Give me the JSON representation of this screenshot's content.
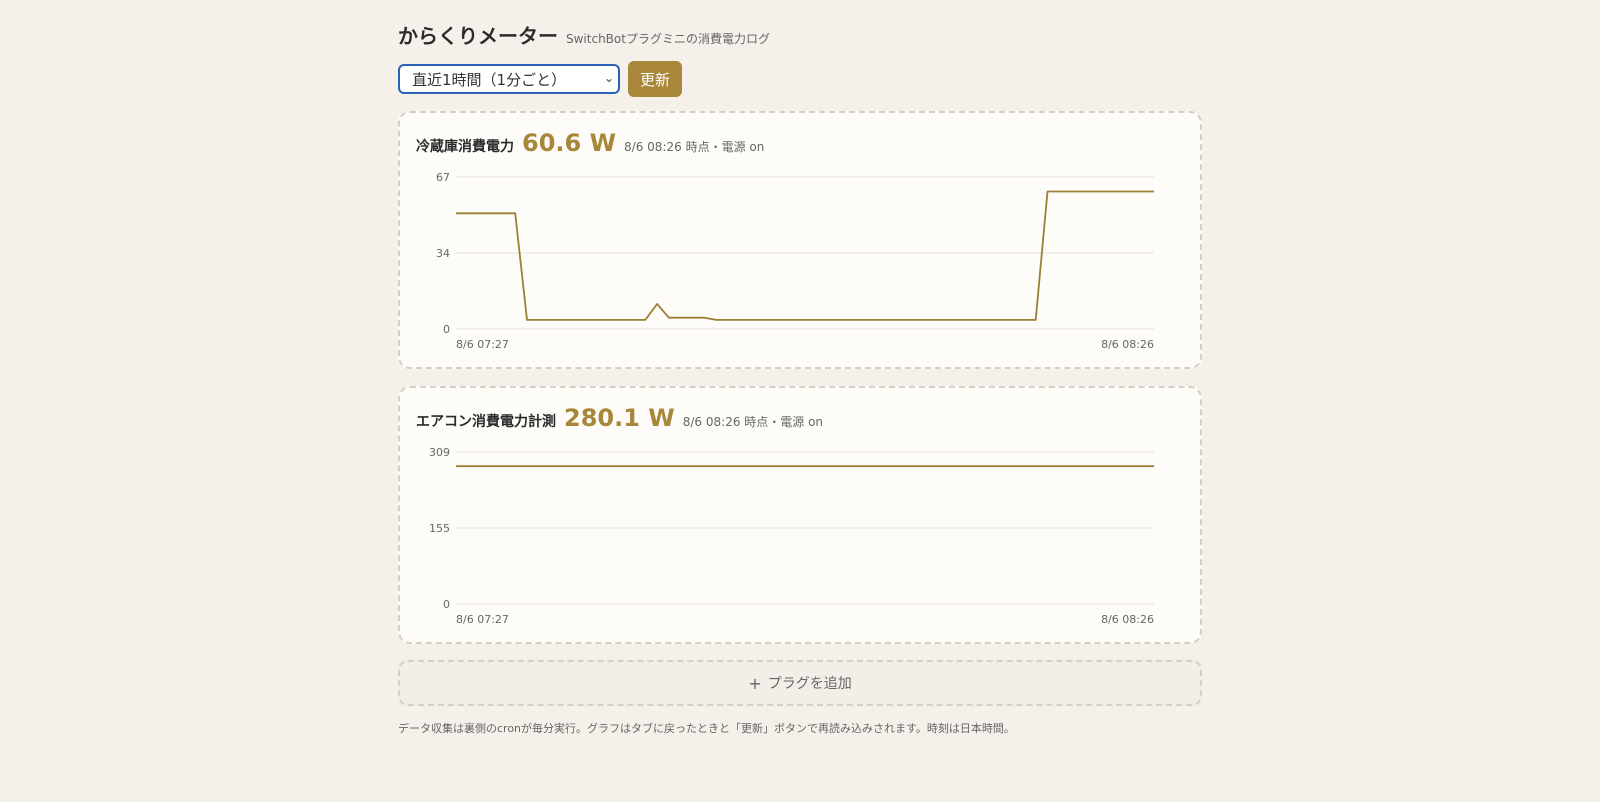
{
  "header": {
    "title": "からくりメーター",
    "subtitle": "SwitchBotプラグミニの消費電力ログ"
  },
  "controls": {
    "range_selected": "直近1時間（1分ごと）",
    "refresh_label": "更新"
  },
  "cards": [
    {
      "name": "冷蔵庫消費電力",
      "value": "60.6 W",
      "meta": "8/6 08:26 時点・電源 on",
      "chart_data": {
        "type": "line",
        "x_labels": [
          "8/6 07:27",
          "8/6 08:26"
        ],
        "y_ticks": [
          "67",
          "34",
          "0"
        ],
        "ylim": [
          0,
          67
        ],
        "line_color": "#9c7e35",
        "values": [
          51,
          51,
          51,
          51,
          51,
          51,
          4,
          4,
          4,
          4,
          4,
          4,
          4,
          4,
          4,
          4,
          4,
          11,
          5,
          5,
          5,
          5,
          4,
          4,
          4,
          4,
          4,
          4,
          4,
          4,
          4,
          4,
          4,
          4,
          4,
          4,
          4,
          4,
          4,
          4,
          4,
          4,
          4,
          4,
          4,
          4,
          4,
          4,
          4,
          4,
          60.6,
          60.6,
          60.6,
          60.6,
          60.6,
          60.6,
          60.6,
          60.6,
          60.6,
          60.6
        ]
      }
    },
    {
      "name": "エアコン消費電力計測",
      "value": "280.1 W",
      "meta": "8/6 08:26 時点・電源 on",
      "chart_data": {
        "type": "line",
        "x_labels": [
          "8/6 07:27",
          "8/6 08:26"
        ],
        "y_ticks": [
          "309",
          "155",
          "0"
        ],
        "ylim": [
          0,
          309
        ],
        "line_color": "#9c7e35",
        "values": [
          280.1,
          280.1,
          280.1,
          280.1,
          280.1,
          280.1,
          280.1,
          280.1,
          280.1,
          280.1,
          280.1,
          280.1,
          280.1,
          280.1,
          280.1,
          280.1,
          280.1,
          280.1,
          280.1,
          280.1,
          280.1,
          280.1,
          280.1,
          280.1,
          280.1,
          280.1,
          280.1,
          280.1,
          280.1,
          280.1,
          280.1,
          280.1,
          280.1,
          280.1,
          280.1,
          280.1,
          280.1,
          280.1,
          280.1,
          280.1,
          280.1,
          280.1,
          280.1,
          280.1,
          280.1,
          280.1,
          280.1,
          280.1,
          280.1,
          280.1,
          280.1,
          280.1,
          280.1,
          280.1,
          280.1,
          280.1,
          280.1,
          280.1,
          280.1,
          280.1
        ]
      }
    }
  ],
  "add_plug": {
    "icon": "plus-icon",
    "label": "プラグを追加"
  },
  "footnote": "データ収集は裏側のcronが毎分実行。グラフはタブに戻ったときと「更新」ボタンで再読み込みされます。時刻は日本時間。"
}
